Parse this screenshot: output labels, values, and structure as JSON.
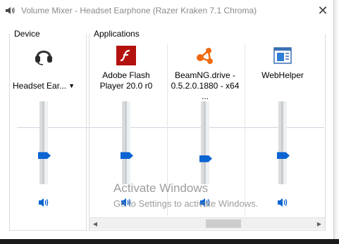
{
  "window": {
    "title": "Volume Mixer - Headset Earphone (Razer Kraken 7.1 Chroma)",
    "close_glyph": "✕"
  },
  "groups": {
    "device": "Device",
    "applications": "Applications"
  },
  "device": {
    "label": "Headset Ear...",
    "icon": "headset-icon",
    "volume_fraction": 0.33
  },
  "apps": [
    {
      "label": "Adobe Flash\nPlayer 20.0 r0",
      "icon": "adobe-flash-icon",
      "volume_fraction": 0.33
    },
    {
      "label": "BeamNG.drive -\n0.5.2.0.1880 - x64 ...",
      "icon": "beamng-icon",
      "volume_fraction": 0.29
    },
    {
      "label": "WebHelper",
      "icon": "webhelper-icon",
      "volume_fraction": 0.33
    }
  ],
  "watermark": {
    "title": "Activate Windows",
    "subtitle": "Go to Settings to activate Windows."
  },
  "colors": {
    "accent": "#0a64d2",
    "flash_red": "#b3120f",
    "beamng_orange": "#f06a0f"
  }
}
